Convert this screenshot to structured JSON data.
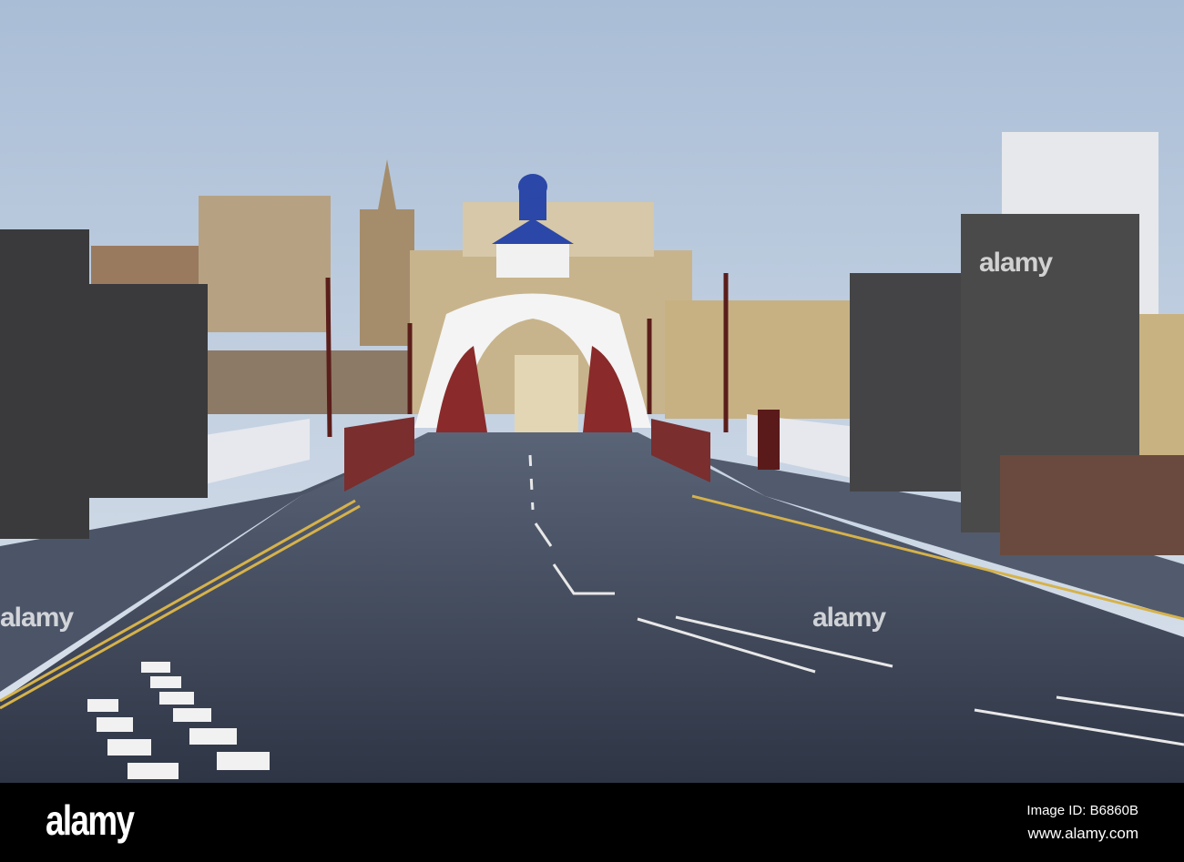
{
  "watermark": {
    "brand": "alamy",
    "image_id": "Image ID: B6860B",
    "url": "www.alamy.com"
  },
  "colors": {
    "sky_top": "#a9bdd6",
    "sky_bottom": "#dfe6ee",
    "road": "#3b4457",
    "stone": "#3a3a3c",
    "bar": "#000000"
  }
}
